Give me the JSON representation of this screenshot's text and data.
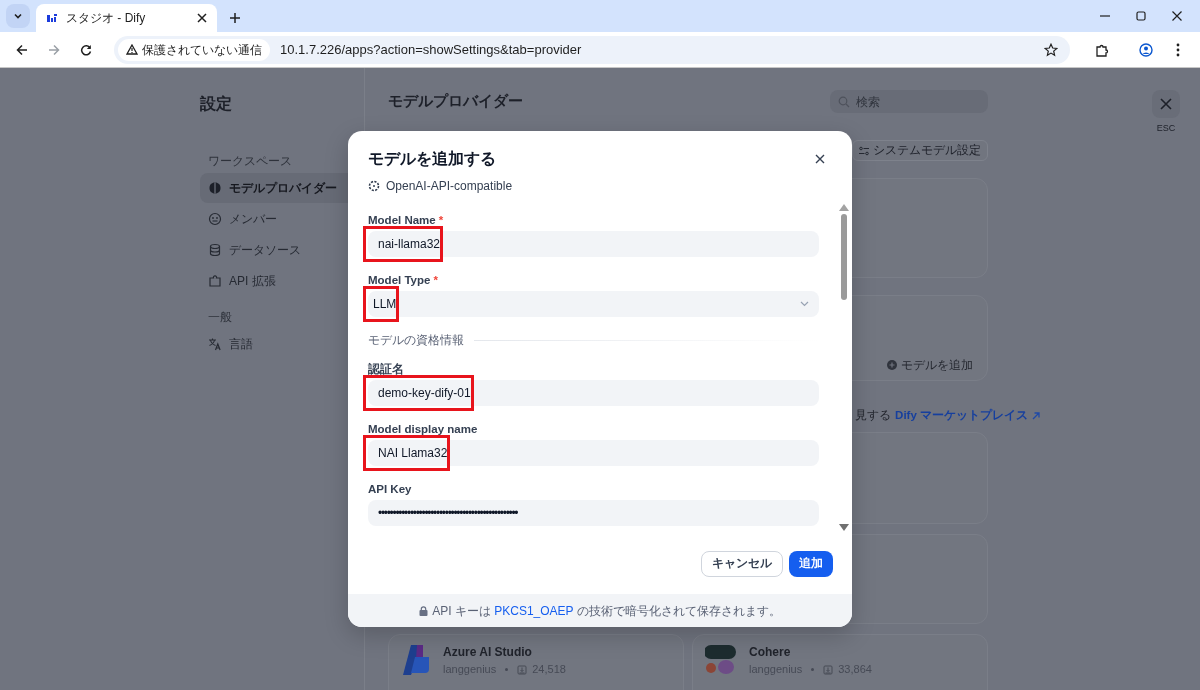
{
  "browser": {
    "tab_title": "スタジオ - Dify",
    "security_label": "保護されていない通信",
    "url": "10.1.7.226/apps?action=showSettings&tab=provider"
  },
  "settings": {
    "title": "設定",
    "sections": [
      {
        "heading": "ワークスペース",
        "items": [
          {
            "label": "モデルプロバイダー",
            "selected": true
          },
          {
            "label": "メンバー",
            "selected": false
          },
          {
            "label": "データソース",
            "selected": false
          },
          {
            "label": "API 拡張",
            "selected": false
          }
        ]
      },
      {
        "heading": "一般",
        "items": [
          {
            "label": "言語",
            "selected": false
          }
        ]
      }
    ]
  },
  "main": {
    "title": "モデルプロバイダー",
    "search_placeholder": "検索",
    "close_hint": "ESC",
    "system_model_button": "システムモデル設定",
    "add_model_link": "モデルを追加",
    "marketplace_prefix": "見する",
    "marketplace_link": "Dify マーケットプレイス",
    "providers": [
      {
        "name": "Azure AI Studio",
        "author": "langgenius",
        "installs": "24,518"
      },
      {
        "name": "Cohere",
        "author": "langgenius",
        "installs": "33,864"
      }
    ]
  },
  "modal": {
    "title": "モデルを追加する",
    "provider": "OpenAI-API-compatible",
    "fields": [
      {
        "kind": "text",
        "label": "Model Name",
        "required_mark": "*",
        "value": "nai-llama32",
        "highlighted": true
      },
      {
        "kind": "select",
        "label": "Model Type",
        "required_mark": "*",
        "value": "LLM",
        "highlighted": true
      },
      {
        "kind": "divider",
        "label": "モデルの資格情報"
      },
      {
        "kind": "text",
        "label": "認証名",
        "value": "demo-key-dify-01",
        "highlighted": true
      },
      {
        "kind": "text",
        "label": "Model display name",
        "value": "NAI Llama32",
        "highlighted": true
      },
      {
        "kind": "text",
        "label": "API Key",
        "value": "••••••••••••••••••••••••••••••••••••••••••••••••",
        "highlighted": false
      }
    ],
    "cancel_button": "キャンセル",
    "submit_button": "追加",
    "footer": {
      "before": "API キーは",
      "link": "PKCS1_OAEP",
      "after": "の技術で暗号化されて保存されます。"
    }
  }
}
